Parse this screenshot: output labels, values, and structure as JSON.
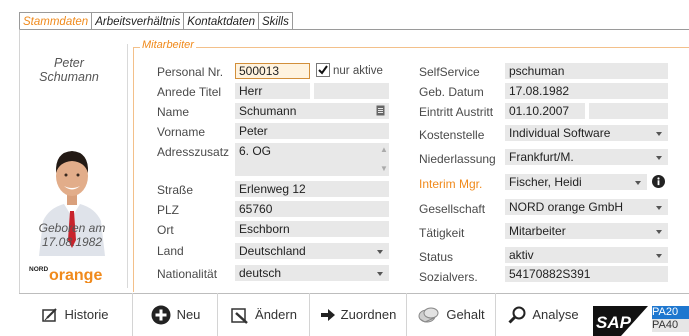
{
  "tabs": [
    "Stammdaten",
    "Arbeitsverhältnis",
    "Kontaktdaten",
    "Skills"
  ],
  "person": {
    "first_name": "Peter",
    "last_name": "Schumann",
    "born_label": "Geboren am",
    "born_date": "17.08.1982",
    "logo_small": "NORD",
    "logo_big": "orange"
  },
  "section_title": "Mitarbeiter",
  "fields": {
    "personal_nr": {
      "label": "Personal Nr.",
      "value": "500013"
    },
    "nur_aktive": {
      "label": "nur aktive",
      "checked": true
    },
    "anrede": {
      "label": "Anrede Titel",
      "value": "Herr",
      "value2": ""
    },
    "name": {
      "label": "Name",
      "value": "Schumann"
    },
    "vorname": {
      "label": "Vorname",
      "value": "Peter"
    },
    "adresszusatz": {
      "label": "Adresszusatz",
      "value": "6. OG"
    },
    "strasse": {
      "label": "Straße",
      "value": "Erlenweg 12"
    },
    "plz": {
      "label": "PLZ",
      "value": "65760"
    },
    "ort": {
      "label": "Ort",
      "value": "Eschborn"
    },
    "land": {
      "label": "Land",
      "value": "Deutschland"
    },
    "nationalitaet": {
      "label": "Nationalität",
      "value": "deutsch"
    },
    "selfservice": {
      "label": "SelfService",
      "value": "pschuman"
    },
    "geb_datum": {
      "label": "Geb. Datum",
      "value": "17.08.1982"
    },
    "eintritt": {
      "label": "Eintritt Austritt",
      "value": "01.10.2007",
      "value2": ""
    },
    "kostenstelle": {
      "label": "Kostenstelle",
      "value": "Individual Software"
    },
    "niederlassung": {
      "label": "Niederlassung",
      "value": "Frankfurt/M."
    },
    "interim": {
      "label": "Interim Mgr.",
      "value": "Fischer, Heidi"
    },
    "gesellschaft": {
      "label": "Gesellschaft",
      "value": "NORD orange GmbH"
    },
    "taetigkeit": {
      "label": "Tätigkeit",
      "value": "Mitarbeiter"
    },
    "status": {
      "label": "Status",
      "value": "aktiv"
    },
    "sozialvers": {
      "label": "Sozialvers.",
      "value": "54170882S391"
    }
  },
  "toolbar": {
    "historie": "Historie",
    "neu": "Neu",
    "aendern": "Ändern",
    "zuordnen": "Zuordnen",
    "gehalt": "Gehalt",
    "analyse": "Analyse",
    "sap": "SAP",
    "pa20": "PA20",
    "pa40": "PA40"
  },
  "colors": {
    "accent": "#f08a1c",
    "field_bg": "#e8e8e8",
    "sap_blue": "#1e77cf"
  },
  "icons": [
    "notes-icon",
    "info-icon",
    "historie-icon",
    "plus-circle-icon",
    "edit-icon",
    "arrow-right-icon",
    "money-icon",
    "search-icon"
  ]
}
